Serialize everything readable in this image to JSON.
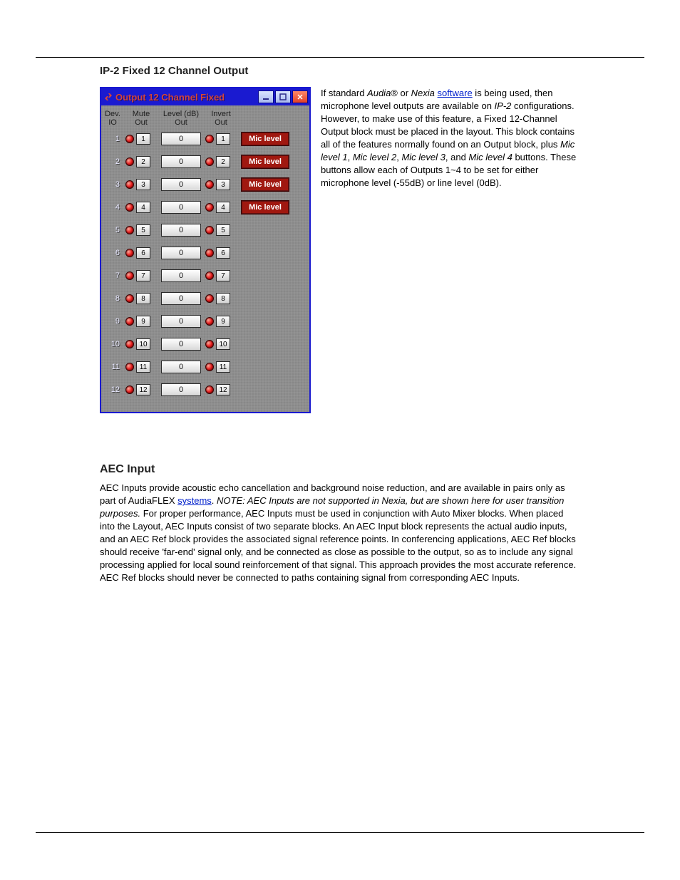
{
  "page_heading": "IP-2 Fixed 12 Channel Output",
  "panel": {
    "title": "Output 12 Channel Fixed",
    "headers": {
      "dev": "Dev.\nIO",
      "mute": "Mute\nOut",
      "level": "Level (dB)\nOut",
      "invert": "Invert\nOut"
    },
    "mic_label": "Mic level",
    "channels": [
      {
        "n": "1",
        "level": "0",
        "mic": true
      },
      {
        "n": "2",
        "level": "0",
        "mic": true
      },
      {
        "n": "3",
        "level": "0",
        "mic": true
      },
      {
        "n": "4",
        "level": "0",
        "mic": true
      },
      {
        "n": "5",
        "level": "0",
        "mic": false
      },
      {
        "n": "6",
        "level": "0",
        "mic": false
      },
      {
        "n": "7",
        "level": "0",
        "mic": false
      },
      {
        "n": "8",
        "level": "0",
        "mic": false
      },
      {
        "n": "9",
        "level": "0",
        "mic": false
      },
      {
        "n": "10",
        "level": "0",
        "mic": false
      },
      {
        "n": "11",
        "level": "0",
        "mic": false
      },
      {
        "n": "12",
        "level": "0",
        "mic": false
      }
    ]
  },
  "para1": {
    "a": "If standard ",
    "b": "Audia",
    "c": "® or ",
    "d": "Nexia",
    "e": " ",
    "link1": "software",
    "f": " is being used, then microphone level outputs are available on ",
    "g": "IP-2",
    "h": " configurations. However, to make use of this feature, a Fixed 12-Channel Output block must be placed in the layout. This block contains all of the features normally found on an Output block, plus ",
    "btn1": "Mic level 1",
    "i": ", ",
    "btn2": "Mic level 2",
    "j": ", ",
    "btn3": "Mic level 3",
    "k": ", and ",
    "btn4": "Mic level 4",
    "l": " buttons. These buttons allow each of Outputs 1~4 to be set for either microphone level (-55dB) or line level (0dB)."
  },
  "heading2": "AEC Input",
  "para2": {
    "a": "AEC Inputs provide acoustic echo cancellation and background noise reduction, and are available in pairs only as part of AudiaFLEX ",
    "link1": "systems",
    "b": ". ",
    "c": "NOTE: AEC Inputs are not supported in Nexia, but are shown here for user transition purposes.",
    "d": " For proper performance, AEC Inputs must be used in conjunction with Auto Mixer blocks. When placed into the Layout, AEC Inputs consist of two separate blocks. An AEC Input block represents the actual audio inputs, and an AEC Ref block provides the associated signal reference points. In conferencing applications, AEC Ref blocks should receive 'far-end' signal only, and be connected as close as possible to the output, so as to include any signal processing applied for local sound reinforcement of that signal. This approach provides the most accurate reference. AEC Ref blocks should never be connected to paths containing signal from corresponding AEC Inputs."
  }
}
